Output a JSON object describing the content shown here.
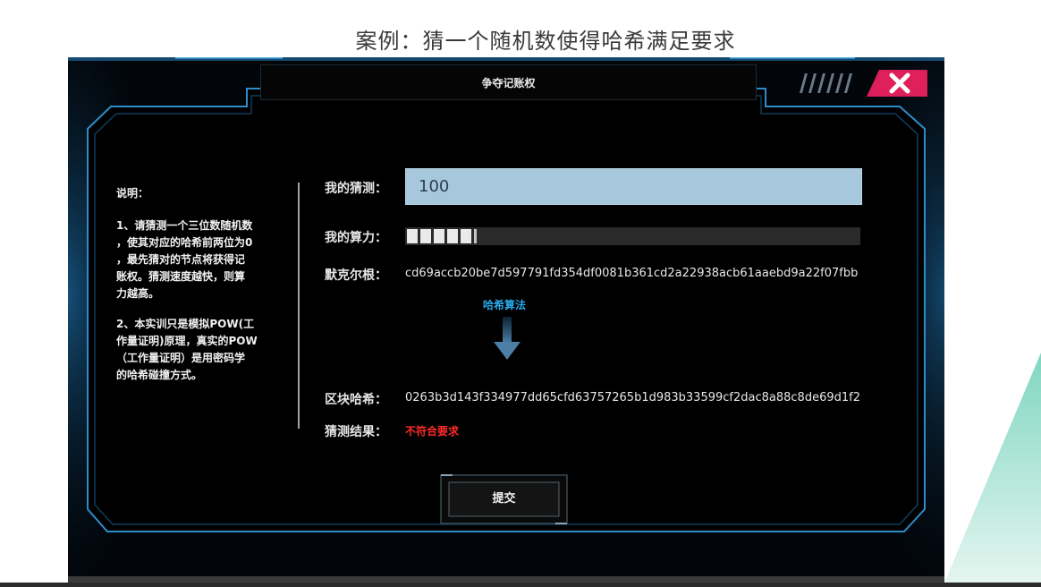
{
  "slide": {
    "title": "案例：猜一个随机数使得哈希满足要求"
  },
  "dialog": {
    "title": "争夺记账权",
    "close_icon": "close-x-icon",
    "accent_color": "#e0205a",
    "instructions": {
      "heading": "说明：",
      "paragraph1": "1、请猜测一个三位数随机数\n，使其对应的哈希前两位为0\n，最先猜对的节点将获得记\n账权。猜测速度越快，则算\n力越高。",
      "paragraph2": "2、本实训只是模拟POW(工\n作量证明)原理，真实的POW\n（工作量证明）是用密码学\n的哈希碰撞方式。"
    },
    "guess": {
      "label": "我的猜测：",
      "value": "100"
    },
    "hashpower": {
      "label": "我的算力：",
      "progress": 0.16
    },
    "merkle_root": {
      "label": "默克尔根：",
      "value": "cd69accb20be7d597791fd354df0081b361cd2a22938acb61aaebd9a22f07fbb"
    },
    "hash_algorithm_label": "哈希算法",
    "block_hash": {
      "label": "区块哈希：",
      "value": "0263b3d143f334977dd65cfd63757265b1d983b33599cf2dac8a88c8de69d1f2"
    },
    "result": {
      "label": "猜测结果：",
      "value": "不符合要求",
      "color": "#ff2a2a"
    },
    "submit_label": "提交"
  }
}
